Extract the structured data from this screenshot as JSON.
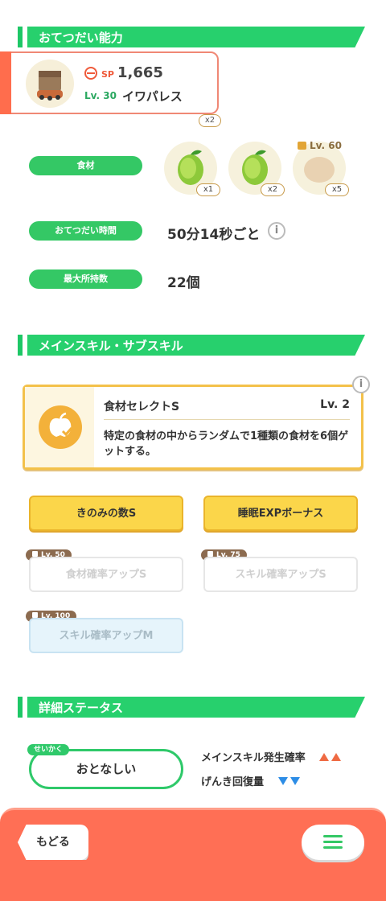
{
  "sections": {
    "help_ability": "おてつだい能力",
    "skills": "メインスキル・サブスキル",
    "details": "詳細ステータス"
  },
  "pokemon": {
    "sp_label": "SP",
    "sp_value": "1,665",
    "level": "Lv. 30",
    "name": "イワパレス",
    "top_badge": "x2"
  },
  "ingredients": {
    "label": "食材",
    "items": [
      {
        "icon": "green-melon",
        "qty": "x1"
      },
      {
        "icon": "green-melon",
        "qty": "x2"
      },
      {
        "icon": "potato",
        "qty": "x5",
        "unlock": "Lv. 60"
      }
    ]
  },
  "help_time": {
    "label": "おてつだい時間",
    "value": "50分14秒ごと"
  },
  "max_carry": {
    "label": "最大所持数",
    "value": "22個"
  },
  "main_skill": {
    "name": "食材セレクトS",
    "level": "Lv. 2",
    "description": "特定の食材の中からランダムで1種類の食材を6個ゲットする。"
  },
  "sub_skills": [
    {
      "label": "きのみの数S",
      "state": "active"
    },
    {
      "label": "睡眠EXPボーナス",
      "state": "active"
    },
    {
      "label": "食材確率アップS",
      "state": "locked",
      "unlock": "Lv. 50"
    },
    {
      "label": "スキル確率アップS",
      "state": "locked",
      "unlock": "Lv. 75"
    },
    {
      "label": "スキル確率アップM",
      "state": "locked",
      "unlock": "Lv. 100"
    }
  ],
  "nature": {
    "tag": "せいかく",
    "value": "おとなしい",
    "up_stat": "メインスキル発生確率",
    "down_stat": "げんき回復量"
  },
  "footer": {
    "back_label": "もどる"
  },
  "colors": {
    "accent_green": "#27d06d",
    "footer": "#ff6f55",
    "skill_gold": "#f3c14a"
  }
}
